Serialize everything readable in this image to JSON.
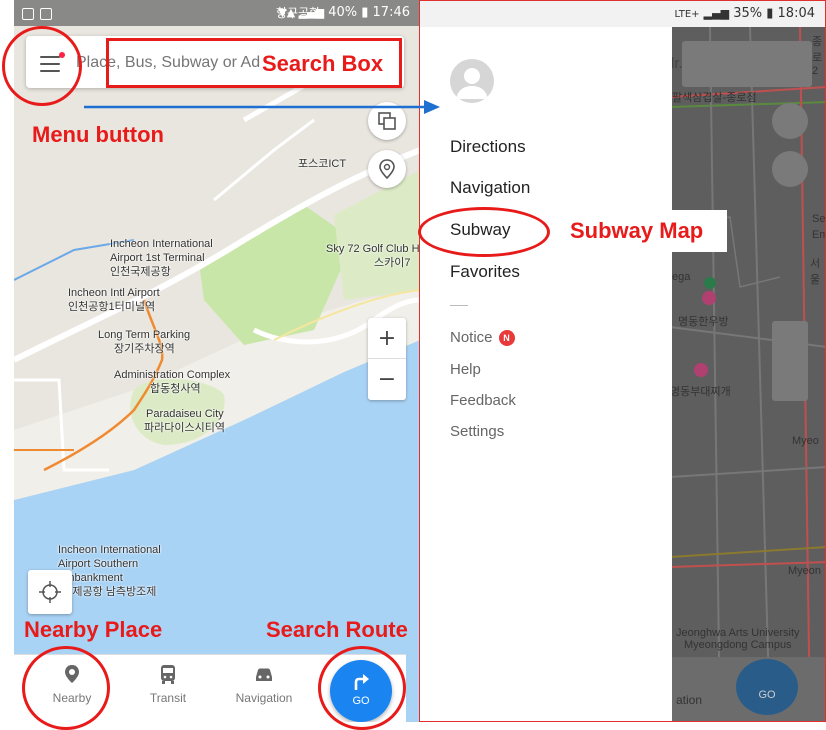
{
  "left_phone": {
    "status": {
      "battery": "40%",
      "time": "17:46",
      "top_label": "항구공항"
    },
    "search": {
      "placeholder": "Place, Bus, Subway or Ad"
    },
    "map_labels": {
      "posco": "포스코ICT",
      "sky72_en": "Sky 72 Golf Club H",
      "sky72_ko": "스카이7",
      "t1_en": "Incheon International\nAirport 1st Terminal",
      "t1_ko": "인천국제공항",
      "intl_en": "Incheon Intl Airport",
      "intl_ko": "인천공항1터미널역",
      "parking_en": "Long Term Parking",
      "parking_ko": "장기주차장역",
      "admin_en": "Administration Complex",
      "admin_ko": "합동청사역",
      "paradise_en": "Paradaiseu City",
      "paradise_ko": "파라다이스시티역",
      "south_en": "Incheon International\nAirport Southern\nEmbankment",
      "south_ko": "인천국제공항 남측방조제"
    },
    "zoom": {
      "plus": "+",
      "minus": "−"
    },
    "nav": {
      "nearby": "Nearby",
      "transit": "Transit",
      "navigation": "Navigation",
      "go": "GO"
    }
  },
  "annotations": {
    "menu_button": "Menu button",
    "search_box": "Search Box",
    "nearby_place": "Nearby Place",
    "search_route": "Search Route",
    "subway_map": "Subway Map"
  },
  "right_phone": {
    "status": {
      "battery": "35%",
      "time": "18:04",
      "network": "LTE+"
    },
    "drawer": {
      "items": [
        "Directions",
        "Navigation",
        "Subway",
        "Favorites"
      ],
      "sub_items": [
        "Notice",
        "Help",
        "Feedback",
        "Settings"
      ],
      "notice_badge": "N"
    },
    "background_labels": {
      "road": "팔색삼겹살-종로점",
      "han": "명동한우방",
      "dae": "명동부대찌개",
      "jeonghwa": "Jeonghwa Arts University\nMyeongdong Campus",
      "myeo1": "Myeo",
      "myeo2": "Myeon",
      "seoul": "서울",
      "ega": "ega",
      "em": "Em",
      "se": "Se",
      "dr": "dr.",
      "jongno": "종로2",
      "ation": "ation",
      "go": "GO"
    }
  },
  "colors": {
    "accent_red": "#e81b1b",
    "go_blue": "#1a84f0",
    "water": "#a9d3f5",
    "park": "#c8e6a8"
  }
}
